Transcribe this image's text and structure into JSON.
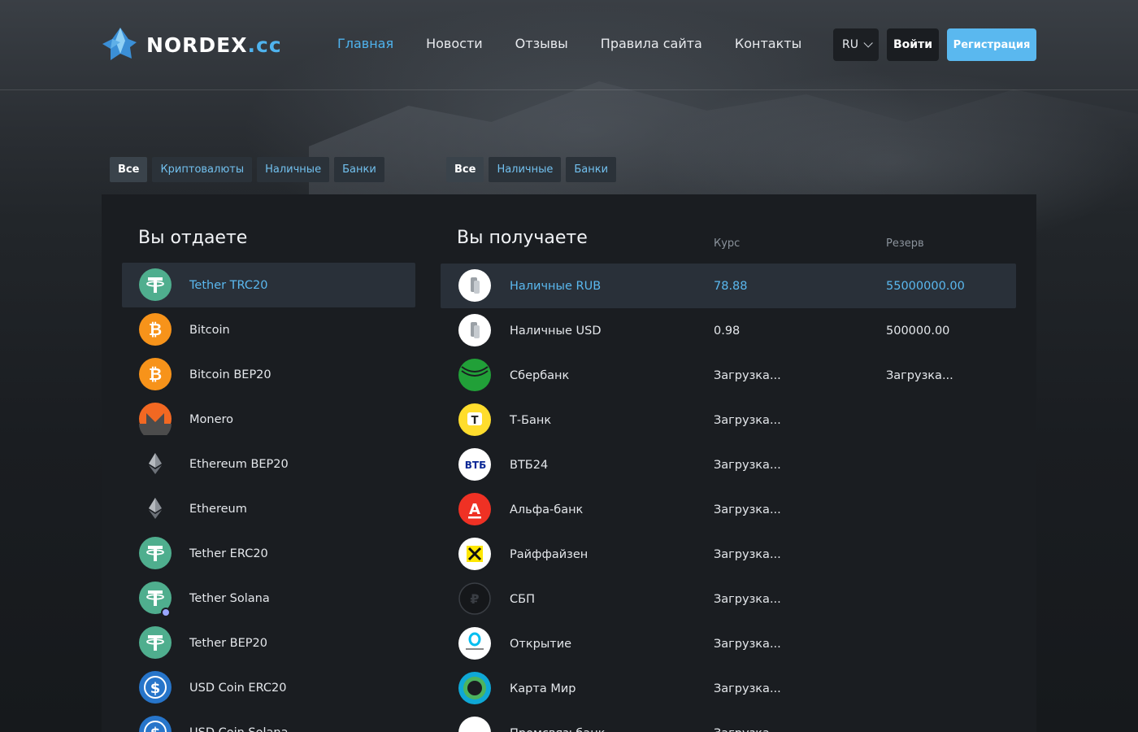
{
  "brand": {
    "name": "NORDEX",
    "tld": ".cc"
  },
  "nav": [
    {
      "label": "Главная",
      "active": true
    },
    {
      "label": "Новости",
      "active": false
    },
    {
      "label": "Отзывы",
      "active": false
    },
    {
      "label": "Правила сайта",
      "active": false
    },
    {
      "label": "Контакты",
      "active": false
    }
  ],
  "header": {
    "lang": "RU",
    "login": "Войти",
    "register": "Регистрация"
  },
  "give_filters": [
    "Все",
    "Криптовалюты",
    "Наличные",
    "Банки"
  ],
  "get_filters": [
    "Все",
    "Наличные",
    "Банки"
  ],
  "give": {
    "title": "Вы отдаете",
    "items": [
      {
        "name": "Tether TRC20",
        "icon": "tether-icon",
        "selected": true
      },
      {
        "name": "Bitcoin",
        "icon": "bitcoin-icon"
      },
      {
        "name": "Bitcoin BEP20",
        "icon": "bitcoin-icon"
      },
      {
        "name": "Monero",
        "icon": "monero-icon"
      },
      {
        "name": "Ethereum BEP20",
        "icon": "ethereum-icon"
      },
      {
        "name": "Ethereum",
        "icon": "ethereum-icon"
      },
      {
        "name": "Tether ERC20",
        "icon": "tether-icon"
      },
      {
        "name": "Tether Solana",
        "icon": "tether-icon"
      },
      {
        "name": "Tether BEP20",
        "icon": "tether-icon"
      },
      {
        "name": "USD Coin ERC20",
        "icon": "usdc-icon"
      },
      {
        "name": "USD Coin Solana",
        "icon": "usdc-icon"
      }
    ]
  },
  "get": {
    "title": "Вы получаете",
    "rate_header": "Курс",
    "reserve_header": "Резерв",
    "items": [
      {
        "name": "Наличные RUB",
        "rate": "78.88",
        "reserve": "55000000.00",
        "icon": "cash-icon",
        "selected": true
      },
      {
        "name": "Наличные USD",
        "rate": "0.98",
        "reserve": "500000.00",
        "icon": "cash-icon"
      },
      {
        "name": "Сбербанк",
        "rate": "Загрузка...",
        "reserve": "Загрузка...",
        "icon": "sberbank-icon"
      },
      {
        "name": "Т-Банк",
        "rate": "Загрузка...",
        "reserve": "",
        "icon": "tbank-icon"
      },
      {
        "name": "ВТБ24",
        "rate": "Загрузка...",
        "reserve": "",
        "icon": "vtb-icon"
      },
      {
        "name": "Альфа-банк",
        "rate": "Загрузка...",
        "reserve": "",
        "icon": "alfabank-icon"
      },
      {
        "name": "Райффайзен",
        "rate": "Загрузка...",
        "reserve": "",
        "icon": "raiffeisen-icon"
      },
      {
        "name": "СБП",
        "rate": "Загрузка...",
        "reserve": "",
        "icon": "sbp-icon"
      },
      {
        "name": "Открытие",
        "rate": "Загрузка...",
        "reserve": "",
        "icon": "otkritie-icon"
      },
      {
        "name": "Карта Мир",
        "rate": "Загрузка...",
        "reserve": "",
        "icon": "mir-icon"
      },
      {
        "name": "Промсвязьбанк",
        "rate": "Загрузка...",
        "reserve": "",
        "icon": "psb-icon"
      }
    ]
  }
}
